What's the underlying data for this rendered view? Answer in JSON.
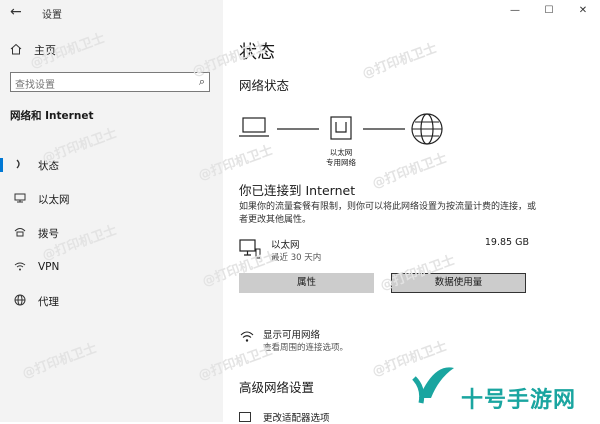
{
  "window": {
    "title": "设置",
    "controls": [
      "minimize",
      "maximize",
      "close"
    ]
  },
  "sidebar": {
    "home_label": "主页",
    "search_placeholder": "查找设置",
    "section_title": "网络和 Internet",
    "items": [
      {
        "label": "状态",
        "icon": "status-icon",
        "active": true
      },
      {
        "label": "以太网",
        "icon": "ethernet-icon",
        "active": false
      },
      {
        "label": "拨号",
        "icon": "dialup-icon",
        "active": false
      },
      {
        "label": "VPN",
        "icon": "vpn-icon",
        "active": false
      },
      {
        "label": "代理",
        "icon": "globe-icon",
        "active": false
      }
    ]
  },
  "main": {
    "page_title": "状态",
    "network_status_title": "网络状态",
    "diagram": {
      "adapter_label_1": "以太网",
      "adapter_label_2": "专用网络"
    },
    "connected_title": "你已连接到 Internet",
    "description": "如果你的流量套餐有限制，则你可以将此网络设置为按流量计费的连接，或者更改其他属性。",
    "connection": {
      "name": "以太网",
      "period": "最近 30 天内",
      "usage": "19.85 GB"
    },
    "buttons": {
      "properties": "属性",
      "data_usage": "数据使用量"
    },
    "show_networks": {
      "title": "显示可用网络",
      "desc": "查看周围的连接选项。"
    },
    "advanced_title": "高级网络设置",
    "advanced_item": "更改适配器选项"
  },
  "watermarks": {
    "repeated": "@打印机卫士",
    "brand": "十号手游网"
  },
  "colors": {
    "accent": "#0078d4",
    "sidebar_bg": "#f3f3f3",
    "brand": "#1aa5a0"
  }
}
